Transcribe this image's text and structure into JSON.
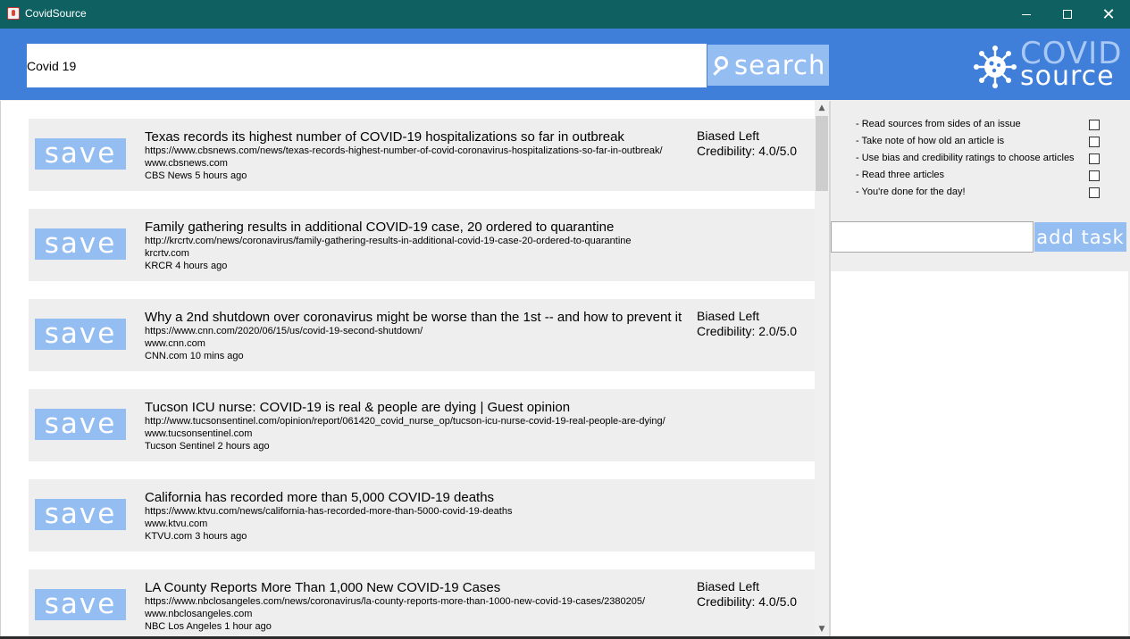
{
  "window": {
    "title": "CovidSource",
    "minimize_icon": "minimize-icon",
    "maximize_icon": "maximize-icon",
    "close_label": "✕"
  },
  "header": {
    "search_value": "Covid 19",
    "search_label": "search",
    "logo_top": "COVID",
    "logo_bottom": "source"
  },
  "colors": {
    "titlebar": "#0f6161",
    "header": "#3f7fd9",
    "button": "#94bdf2",
    "panel": "#eeeeee"
  },
  "articles": [
    {
      "save_label": "save",
      "title": "Texas records its highest number of COVID-19 hospitalizations so far in outbreak",
      "url": "https://www.cbsnews.com/news/texas-records-highest-number-of-covid-coronavirus-hospitalizations-so-far-in-outbreak/",
      "domain": "www.cbsnews.com",
      "source": "CBS News 5 hours ago",
      "bias": "Biased Left",
      "credibility": "Credibility: 4.0/5.0"
    },
    {
      "save_label": "save",
      "title": "Family gathering results in additional COVID-19 case, 20 ordered to quarantine",
      "url": "http://krcrtv.com/news/coronavirus/family-gathering-results-in-additional-covid-19-case-20-ordered-to-quarantine",
      "domain": "krcrtv.com",
      "source": "KRCR 4 hours ago",
      "bias": "",
      "credibility": ""
    },
    {
      "save_label": "save",
      "title": "Why a 2nd shutdown over coronavirus might be worse than the 1st -- and how to prevent it",
      "url": "https://www.cnn.com/2020/06/15/us/covid-19-second-shutdown/",
      "domain": "www.cnn.com",
      "source": "CNN.com 10 mins ago",
      "bias": "Biased Left",
      "credibility": "Credibility: 2.0/5.0"
    },
    {
      "save_label": "save",
      "title": "Tucson ICU nurse: COVID-19 is real & people are dying | Guest opinion",
      "url": "http://www.tucsonsentinel.com/opinion/report/061420_covid_nurse_op/tucson-icu-nurse-covid-19-real-people-are-dying/",
      "domain": "www.tucsonsentinel.com",
      "source": "Tucson Sentinel 2 hours ago",
      "bias": "",
      "credibility": ""
    },
    {
      "save_label": "save",
      "title": "California has recorded more than 5,000 COVID-19 deaths",
      "url": "https://www.ktvu.com/news/california-has-recorded-more-than-5000-covid-19-deaths",
      "domain": "www.ktvu.com",
      "source": "KTVU.com 3 hours ago",
      "bias": "",
      "credibility": ""
    },
    {
      "save_label": "save",
      "title": "LA County Reports More Than 1,000 New COVID-19 Cases",
      "url": "https://www.nbclosangeles.com/news/coronavirus/la-county-reports-more-than-1000-new-covid-19-cases/2380205/",
      "domain": "www.nbclosangeles.com",
      "source": "NBC Los Angeles 1 hour ago",
      "bias": "Biased Left",
      "credibility": "Credibility: 4.0/5.0"
    }
  ],
  "tasks": [
    {
      "label": "-   Read sources from sides of an issue",
      "checked": false
    },
    {
      "label": "-   Take note of how old an article is",
      "checked": false
    },
    {
      "label": "-   Use bias and credibility ratings to choose articles",
      "checked": false
    },
    {
      "label": "-   Read three articles",
      "checked": false
    },
    {
      "label": "-   You're done for the day!",
      "checked": false
    }
  ],
  "task_input": {
    "value": ""
  },
  "add_task_label": "add task"
}
